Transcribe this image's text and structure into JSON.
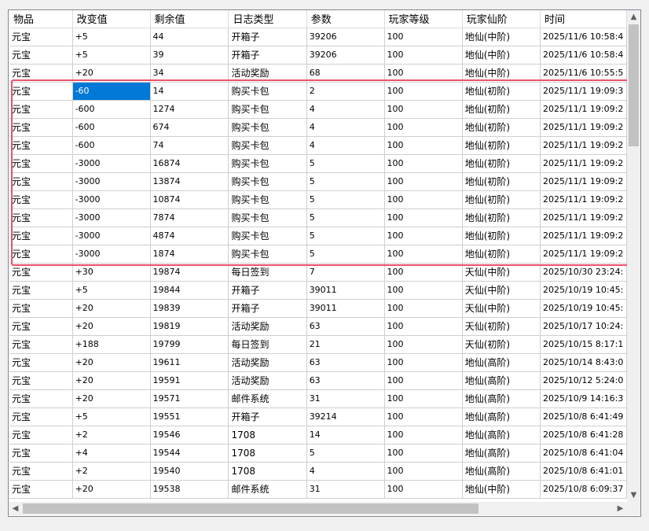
{
  "columns": [
    "物品",
    "改变值",
    "剩余值",
    "日志类型",
    "参数",
    "玩家等级",
    "玩家仙阶",
    "时间"
  ],
  "rows": [
    [
      "元宝",
      "+5",
      "44",
      "开箱子",
      "39206",
      "100",
      "地仙(中阶)",
      "2025/11/6 10:58:4"
    ],
    [
      "元宝",
      "+5",
      "39",
      "开箱子",
      "39206",
      "100",
      "地仙(中阶)",
      "2025/11/6 10:58:4"
    ],
    [
      "元宝",
      "+20",
      "34",
      "活动奖励",
      "68",
      "100",
      "地仙(中阶)",
      "2025/11/6 10:55:5"
    ],
    [
      "元宝",
      "-60",
      "14",
      "购买卡包",
      "2",
      "100",
      "地仙(初阶)",
      "2025/11/1 19:09:3"
    ],
    [
      "元宝",
      "-600",
      "1274",
      "购买卡包",
      "4",
      "100",
      "地仙(初阶)",
      "2025/11/1 19:09:2"
    ],
    [
      "元宝",
      "-600",
      "674",
      "购买卡包",
      "4",
      "100",
      "地仙(初阶)",
      "2025/11/1 19:09:2"
    ],
    [
      "元宝",
      "-600",
      "74",
      "购买卡包",
      "4",
      "100",
      "地仙(初阶)",
      "2025/11/1 19:09:2"
    ],
    [
      "元宝",
      "-3000",
      "16874",
      "购买卡包",
      "5",
      "100",
      "地仙(初阶)",
      "2025/11/1 19:09:2"
    ],
    [
      "元宝",
      "-3000",
      "13874",
      "购买卡包",
      "5",
      "100",
      "地仙(初阶)",
      "2025/11/1 19:09:2"
    ],
    [
      "元宝",
      "-3000",
      "10874",
      "购买卡包",
      "5",
      "100",
      "地仙(初阶)",
      "2025/11/1 19:09:2"
    ],
    [
      "元宝",
      "-3000",
      "7874",
      "购买卡包",
      "5",
      "100",
      "地仙(初阶)",
      "2025/11/1 19:09:2"
    ],
    [
      "元宝",
      "-3000",
      "4874",
      "购买卡包",
      "5",
      "100",
      "地仙(初阶)",
      "2025/11/1 19:09:2"
    ],
    [
      "元宝",
      "-3000",
      "1874",
      "购买卡包",
      "5",
      "100",
      "地仙(初阶)",
      "2025/11/1 19:09:2"
    ],
    [
      "元宝",
      "+30",
      "19874",
      "每日签到",
      "7",
      "100",
      "天仙(中阶)",
      "2025/10/30 23:24:"
    ],
    [
      "元宝",
      "+5",
      "19844",
      "开箱子",
      "39011",
      "100",
      "天仙(中阶)",
      "2025/10/19 10:45:"
    ],
    [
      "元宝",
      "+20",
      "19839",
      "开箱子",
      "39011",
      "100",
      "天仙(中阶)",
      "2025/10/19 10:45:"
    ],
    [
      "元宝",
      "+20",
      "19819",
      "活动奖励",
      "63",
      "100",
      "天仙(初阶)",
      "2025/10/17 10:24:"
    ],
    [
      "元宝",
      "+188",
      "19799",
      "每日签到",
      "21",
      "100",
      "天仙(初阶)",
      "2025/10/15 8:17:1"
    ],
    [
      "元宝",
      "+20",
      "19611",
      "活动奖励",
      "63",
      "100",
      "地仙(高阶)",
      "2025/10/14 8:43:0"
    ],
    [
      "元宝",
      "+20",
      "19591",
      "活动奖励",
      "63",
      "100",
      "地仙(高阶)",
      "2025/10/12 5:24:0"
    ],
    [
      "元宝",
      "+20",
      "19571",
      "邮件系统",
      "31",
      "100",
      "地仙(高阶)",
      "2025/10/9 14:16:3"
    ],
    [
      "元宝",
      "+5",
      "19551",
      "开箱子",
      "39214",
      "100",
      "地仙(高阶)",
      "2025/10/8 6:41:49"
    ],
    [
      "元宝",
      "+2",
      "19546",
      "1708",
      "14",
      "100",
      "地仙(高阶)",
      "2025/10/8 6:41:28"
    ],
    [
      "元宝",
      "+4",
      "19544",
      "1708",
      "5",
      "100",
      "地仙(高阶)",
      "2025/10/8 6:41:04"
    ],
    [
      "元宝",
      "+2",
      "19540",
      "1708",
      "4",
      "100",
      "地仙(高阶)",
      "2025/10/8 6:41:01"
    ],
    [
      "元宝",
      "+20",
      "19538",
      "邮件系统",
      "31",
      "100",
      "地仙(中阶)",
      "2025/10/8 6:09:37"
    ]
  ],
  "selected_row": 3,
  "selected_col": 1,
  "highlight_color": "#e8536a",
  "selection_color": "#0078d7",
  "scrollbar": {
    "up": "▲",
    "down": "▼",
    "left": "◀",
    "right": "▶"
  }
}
